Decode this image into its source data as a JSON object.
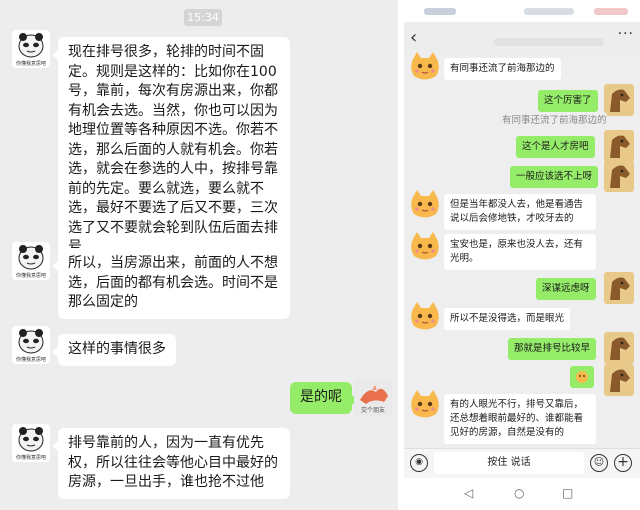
{
  "left_chat": {
    "timestamp": "15:34",
    "sender_avatar_caption": "你懂我意思吧",
    "messages": [
      {
        "text": "现在排号很多，轮排的时间不固定。规则是这样的：比如你在100号，靠前，每次有房源出来，你都有机会去选。当然，你也可以因为地理位置等各种原因不选。你若不选，那么后面的人就有机会。你若选，就会在参选的人中，按排号靠前的先定。要么就选，要么就不选，最好不要选了后又不要，三次选了又不要就会轮到队伍后面去排号"
      },
      {
        "text": "所以，当房源出来，前面的人不想选，后面的都有机会选。时间不是那么固定的"
      },
      {
        "text": "这样的事情很多"
      },
      {
        "text": "是的呢"
      },
      {
        "text": "排号靠前的人，因为一直有优先权，所以往往会等他心目中最好的房源，一旦出手，谁也抢不过他"
      }
    ],
    "own_avatar_caption": "交个朋友"
  },
  "right_chat": {
    "back_glyph": "‹",
    "more_glyph": "···",
    "messages": [
      {
        "text": "有同事还流了前海那边的"
      },
      {
        "text": "这个厉害了"
      },
      {
        "text": "有同事还流了前海那边的"
      },
      {
        "text": "这个是人才房吧"
      },
      {
        "text": "一般应该选不上呀"
      },
      {
        "text": "但是当年都没人去，他是看通告说以后会修地铁，才咬牙去的"
      },
      {
        "text": "宝安也是，原来也没人去，还有光明。"
      },
      {
        "text": "深谋远虑呀"
      },
      {
        "text": "所以不是没得选，而是眼光"
      },
      {
        "text": "那就是排号比较早"
      },
      {
        "text": "有的人眼光不行，排号又靠后，还总想着眼前最好的、谁都能看见好的房源，自然是没有的"
      }
    ],
    "input_placeholder": "按住 说话",
    "nav": {
      "back": "◁",
      "home": "○",
      "recent": "□"
    }
  },
  "colors": {
    "own_bubble": "#95ec69",
    "other_bubble": "#ffffff",
    "chat_bg": "#ededed"
  },
  "icons": [
    "panda-meme-avatar",
    "cat-emoji-avatar",
    "horse-avatar",
    "voice-icon",
    "emoji-icon",
    "plus-icon"
  ]
}
